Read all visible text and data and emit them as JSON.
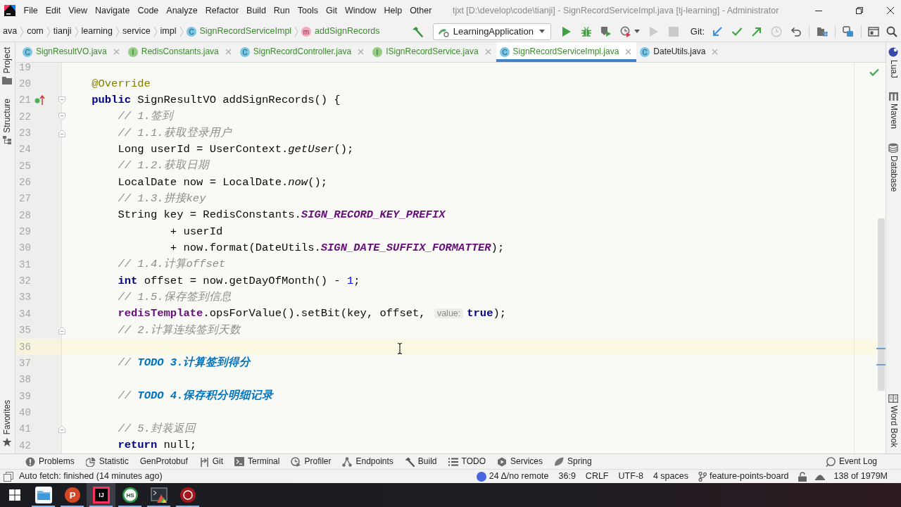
{
  "window": {
    "title": "tjxt [D:\\develop\\code\\tianji] - SignRecordServiceImpl.java [tj-learning] - Administrator",
    "menu": [
      "File",
      "Edit",
      "View",
      "Navigate",
      "Code",
      "Analyze",
      "Refactor",
      "Build",
      "Run",
      "Tools",
      "Git",
      "Window",
      "Help",
      "Other"
    ]
  },
  "breadcrumb": [
    {
      "label": "ava",
      "kind": "package",
      "color": "#1f1f1f"
    },
    {
      "label": "com",
      "kind": "package",
      "color": "#1f1f1f"
    },
    {
      "label": "tianji",
      "kind": "package",
      "color": "#1f1f1f"
    },
    {
      "label": "learning",
      "kind": "package",
      "color": "#1f1f1f"
    },
    {
      "label": "service",
      "kind": "package",
      "color": "#1f1f1f"
    },
    {
      "label": "impl",
      "kind": "package",
      "color": "#1f1f1f"
    },
    {
      "label": "SignRecordServiceImpl",
      "kind": "class",
      "icon_letter": "C",
      "color": "#3d8a2e"
    },
    {
      "label": "addSignRecords",
      "kind": "method",
      "icon_letter": "m",
      "color": "#3d8a2e"
    }
  ],
  "toolbar": {
    "run_config": "LearningApplication",
    "vcs_label": "Git:"
  },
  "left_stripe": {
    "top": [
      {
        "label": "Project",
        "kind": "project"
      },
      {
        "label": "Structure",
        "kind": "structure"
      }
    ],
    "bottom": [
      {
        "label": "Favorites",
        "kind": "favorites"
      }
    ]
  },
  "editor": {
    "tabs": [
      {
        "label": "SignResultVO.java",
        "kind": "class",
        "icon_letter": "C",
        "color": "#3d8a2e",
        "selected": false
      },
      {
        "label": "RedisConstants.java",
        "kind": "interface",
        "icon_letter": "I",
        "color": "#3d8a2e",
        "selected": false
      },
      {
        "label": "SignRecordController.java",
        "kind": "class",
        "icon_letter": "C",
        "color": "#3d8a2e",
        "selected": false
      },
      {
        "label": "ISignRecordService.java",
        "kind": "interface",
        "icon_letter": "I",
        "color": "#3d8a2e",
        "selected": false
      },
      {
        "label": "SignRecordServiceImpl.java",
        "kind": "class",
        "icon_letter": "C",
        "color": "#3d8a2e",
        "selected": true
      },
      {
        "label": "DateUtils.java",
        "kind": "class",
        "icon_letter": "C",
        "color": "#1f1f1f",
        "selected": false
      }
    ],
    "lines": [
      {
        "number": "19",
        "current": false,
        "fold_start": false,
        "fold_end": false,
        "override": false
      },
      {
        "number": "20",
        "current": false,
        "fold_start": false,
        "fold_end": false,
        "override": false,
        "tokens": [
          {
            "text": "    @Override",
            "kind": "annotation"
          }
        ]
      },
      {
        "number": "21",
        "current": false,
        "fold_start": true,
        "fold_end": false,
        "override": true,
        "tokens": [
          {
            "text": "    public",
            "kind": "keyword"
          },
          {
            "text": " SignResultVO addSignRecords() {",
            "kind": "plain"
          }
        ]
      },
      {
        "number": "22",
        "current": false,
        "fold_start": true,
        "fold_end": false,
        "override": false,
        "tokens": [
          {
            "text": "        // 1.签到",
            "kind": "comment"
          }
        ]
      },
      {
        "number": "23",
        "current": false,
        "fold_start": false,
        "fold_end": true,
        "override": false,
        "tokens": [
          {
            "text": "        // 1.1.获取登录用户",
            "kind": "comment"
          }
        ]
      },
      {
        "number": "24",
        "current": false,
        "fold_start": false,
        "fold_end": false,
        "override": false,
        "tokens": [
          {
            "text": "        Long userId = UserContext.",
            "kind": "plain"
          },
          {
            "text": "getUser",
            "kind": "static_call"
          },
          {
            "text": "();",
            "kind": "plain"
          }
        ]
      },
      {
        "number": "25",
        "current": false,
        "fold_start": false,
        "fold_end": false,
        "override": false,
        "tokens": [
          {
            "text": "        // 1.2.获取日期",
            "kind": "comment"
          }
        ]
      },
      {
        "number": "26",
        "current": false,
        "fold_start": false,
        "fold_end": false,
        "override": false,
        "tokens": [
          {
            "text": "        LocalDate now = LocalDate.",
            "kind": "plain"
          },
          {
            "text": "now",
            "kind": "static_call"
          },
          {
            "text": "();",
            "kind": "plain"
          }
        ]
      },
      {
        "number": "27",
        "current": false,
        "fold_start": false,
        "fold_end": false,
        "override": false,
        "tokens": [
          {
            "text": "        // 1.3.拼接key",
            "kind": "comment"
          }
        ]
      },
      {
        "number": "28",
        "current": false,
        "fold_start": false,
        "fold_end": false,
        "override": false,
        "tokens": [
          {
            "text": "        String key = RedisConstants.",
            "kind": "plain"
          },
          {
            "text": "SIGN_RECORD_KEY_PREFIX",
            "kind": "constant"
          }
        ]
      },
      {
        "number": "29",
        "current": false,
        "fold_start": false,
        "fold_end": false,
        "override": false,
        "tokens": [
          {
            "text": "                + userId",
            "kind": "plain"
          }
        ]
      },
      {
        "number": "30",
        "current": false,
        "fold_start": false,
        "fold_end": false,
        "override": false,
        "tokens": [
          {
            "text": "                + now.format(DateUtils.",
            "kind": "plain"
          },
          {
            "text": "SIGN_DATE_SUFFIX_FORMATTER",
            "kind": "constant"
          },
          {
            "text": ");",
            "kind": "plain"
          }
        ]
      },
      {
        "number": "31",
        "current": false,
        "fold_start": false,
        "fold_end": false,
        "override": false,
        "tokens": [
          {
            "text": "        // 1.4.计算offset",
            "kind": "comment"
          }
        ]
      },
      {
        "number": "32",
        "current": false,
        "fold_start": false,
        "fold_end": false,
        "override": false,
        "tokens": [
          {
            "text": "        int",
            "kind": "keyword"
          },
          {
            "text": " offset = now.getDayOfMonth() - ",
            "kind": "plain"
          },
          {
            "text": "1",
            "kind": "number"
          },
          {
            "text": ";",
            "kind": "plain"
          }
        ]
      },
      {
        "number": "33",
        "current": false,
        "fold_start": false,
        "fold_end": false,
        "override": false,
        "tokens": [
          {
            "text": "        // 1.5.保存签到信息",
            "kind": "comment"
          }
        ]
      },
      {
        "number": "34",
        "current": false,
        "fold_start": false,
        "fold_end": false,
        "override": false,
        "tokens": [
          {
            "text": "        redisTemplate",
            "kind": "field"
          },
          {
            "text": ".opsForValue().setBit(key, offset, ",
            "kind": "plain"
          },
          {
            "text": "value:",
            "kind": "hint"
          },
          {
            "text": "true",
            "kind": "keyword"
          },
          {
            "text": ");",
            "kind": "plain"
          }
        ]
      },
      {
        "number": "35",
        "current": false,
        "fold_start": false,
        "fold_end": true,
        "override": false,
        "tokens": [
          {
            "text": "        // 2.计算连续签到天数",
            "kind": "comment"
          }
        ]
      },
      {
        "number": "36",
        "current": true,
        "fold_start": false,
        "fold_end": false,
        "override": false
      },
      {
        "number": "37",
        "current": false,
        "fold_start": false,
        "fold_end": false,
        "override": false,
        "tokens": [
          {
            "text": "        // ",
            "kind": "comment"
          },
          {
            "text": "TODO 3.计算签到得分",
            "kind": "todo"
          }
        ]
      },
      {
        "number": "38",
        "current": false,
        "fold_start": false,
        "fold_end": false,
        "override": false
      },
      {
        "number": "39",
        "current": false,
        "fold_start": false,
        "fold_end": false,
        "override": false,
        "tokens": [
          {
            "text": "        // ",
            "kind": "comment"
          },
          {
            "text": "TODO 4.保存积分明细记录",
            "kind": "todo"
          }
        ]
      },
      {
        "number": "40",
        "current": false,
        "fold_start": false,
        "fold_end": false,
        "override": false
      },
      {
        "number": "41",
        "current": false,
        "fold_start": false,
        "fold_end": true,
        "override": false,
        "tokens": [
          {
            "text": "        // 5.封装返回",
            "kind": "comment"
          }
        ]
      },
      {
        "number": "42",
        "current": false,
        "fold_start": false,
        "fold_end": false,
        "override": false,
        "tokens": [
          {
            "text": "        return",
            "kind": "keyword"
          },
          {
            "text": " null;",
            "kind": "plain"
          }
        ]
      }
    ]
  },
  "right_stripe": {
    "top": [
      {
        "label": "LuaJ",
        "kind": "luaj"
      },
      {
        "label": "Maven",
        "kind": "maven"
      },
      {
        "label": "Database",
        "kind": "database"
      }
    ],
    "bottom": [
      {
        "label": "Word Book",
        "kind": "wordbook"
      }
    ]
  },
  "tool_windows": {
    "left": [
      {
        "label": "Problems",
        "kind": "problems"
      },
      {
        "label": "Statistic",
        "kind": "statistic"
      },
      {
        "label": "GenProtobuf",
        "kind": "plain"
      },
      {
        "label": "Git",
        "kind": "git"
      },
      {
        "label": "Terminal",
        "kind": "terminal"
      },
      {
        "label": "Profiler",
        "kind": "profiler"
      },
      {
        "label": "Endpoints",
        "kind": "endpoints"
      },
      {
        "label": "Build",
        "kind": "build"
      },
      {
        "label": "TODO",
        "kind": "todo"
      },
      {
        "label": "Services",
        "kind": "services"
      },
      {
        "label": "Spring",
        "kind": "spring"
      }
    ],
    "right": [
      {
        "label": "Event Log",
        "kind": "eventlog"
      }
    ]
  },
  "status_bar": {
    "message": "Auto fetch: finished (14 minutes ago)",
    "items": [
      {
        "label": "24 Δ/no remote",
        "kind": "vcs"
      },
      {
        "label": "36:9",
        "kind": "text"
      },
      {
        "label": "CRLF",
        "kind": "text"
      },
      {
        "label": "UTF-8",
        "kind": "text"
      },
      {
        "label": "4 spaces",
        "kind": "text"
      },
      {
        "label": "feature-points-board",
        "kind": "branch"
      },
      {
        "kind": "lock"
      },
      {
        "kind": "inspector"
      },
      {
        "label": "138 of 1979M",
        "kind": "text"
      }
    ]
  },
  "taskbar": [
    {
      "kind": "start",
      "selected": false,
      "running": false
    },
    {
      "kind": "explorer",
      "selected": false,
      "running": true
    },
    {
      "kind": "presentation",
      "glyph": "P",
      "selected": false,
      "running": true
    },
    {
      "kind": "ide",
      "glyph": "IJ",
      "selected": true,
      "running": true
    },
    {
      "kind": "hs",
      "glyph": "HS",
      "selected": false,
      "running": true
    },
    {
      "kind": "terminal",
      "selected": false,
      "running": true
    },
    {
      "kind": "redapp",
      "selected": false,
      "running": true
    }
  ]
}
